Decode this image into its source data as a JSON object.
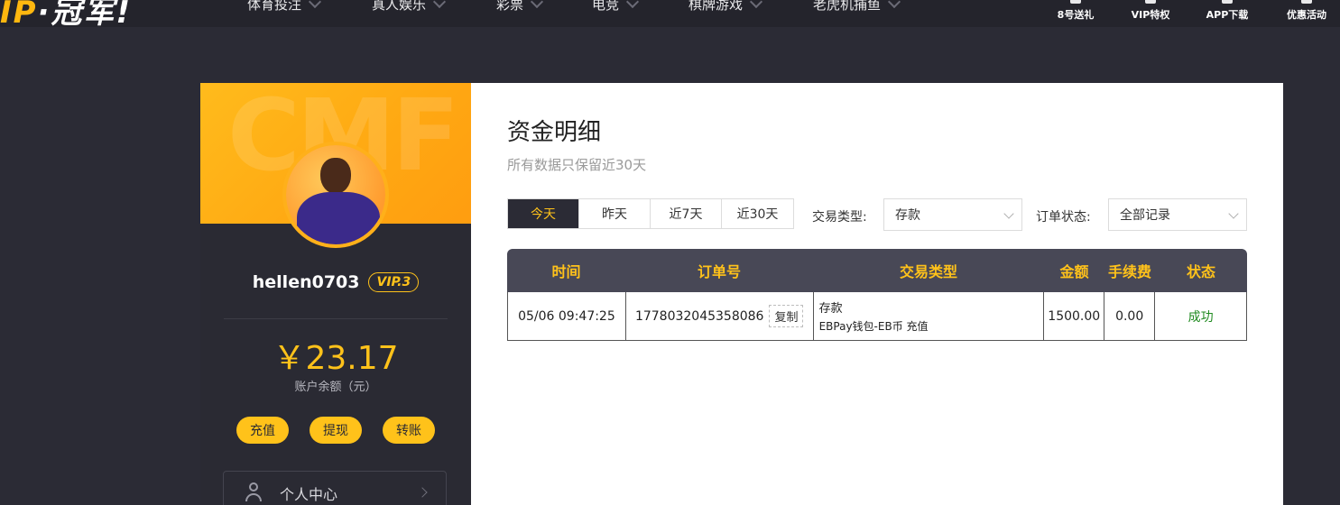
{
  "topnav": {
    "logo_a": "IP",
    "logo_b": "·冠军!",
    "items": [
      "体育投注",
      "真人娱乐",
      "彩票",
      "电竞",
      "棋牌游戏",
      "老虎机捕鱼"
    ],
    "right_links": [
      "8号送礼",
      "VIP特权",
      "APP下载",
      "优惠活动"
    ]
  },
  "sidebar": {
    "watermark": "CMF",
    "username": "hellen0703",
    "vip": "VIP.3",
    "balance": "￥23.17",
    "balance_label": "账户余额（元）",
    "buttons": [
      "充值",
      "提现",
      "转账"
    ],
    "menu_item": "个人中心"
  },
  "main": {
    "title": "资金明细",
    "subtitle": "所有数据只保留近30天",
    "tabs": [
      "今天",
      "昨天",
      "近7天",
      "近30天"
    ],
    "active_tab": "今天",
    "filter_type_label": "交易类型:",
    "filter_type_value": "存款",
    "filter_status_label": "订单状态:",
    "filter_status_value": "全部记录",
    "table": {
      "headers": [
        "时间",
        "订单号",
        "交易类型",
        "金额",
        "手续费",
        "状态"
      ],
      "rows": [
        {
          "time": "05/06 09:47:25",
          "order_no": "1778032045358086",
          "copy": "复制",
          "type": "存款",
          "type_detail": "EBPay钱包-EB币 充值",
          "amount": "1500.00",
          "fee": "0.00",
          "status": "成功"
        }
      ]
    }
  },
  "colors": {
    "accent": "#ffc21a",
    "dark": "#2b2b35",
    "success": "#1f8a1f"
  }
}
